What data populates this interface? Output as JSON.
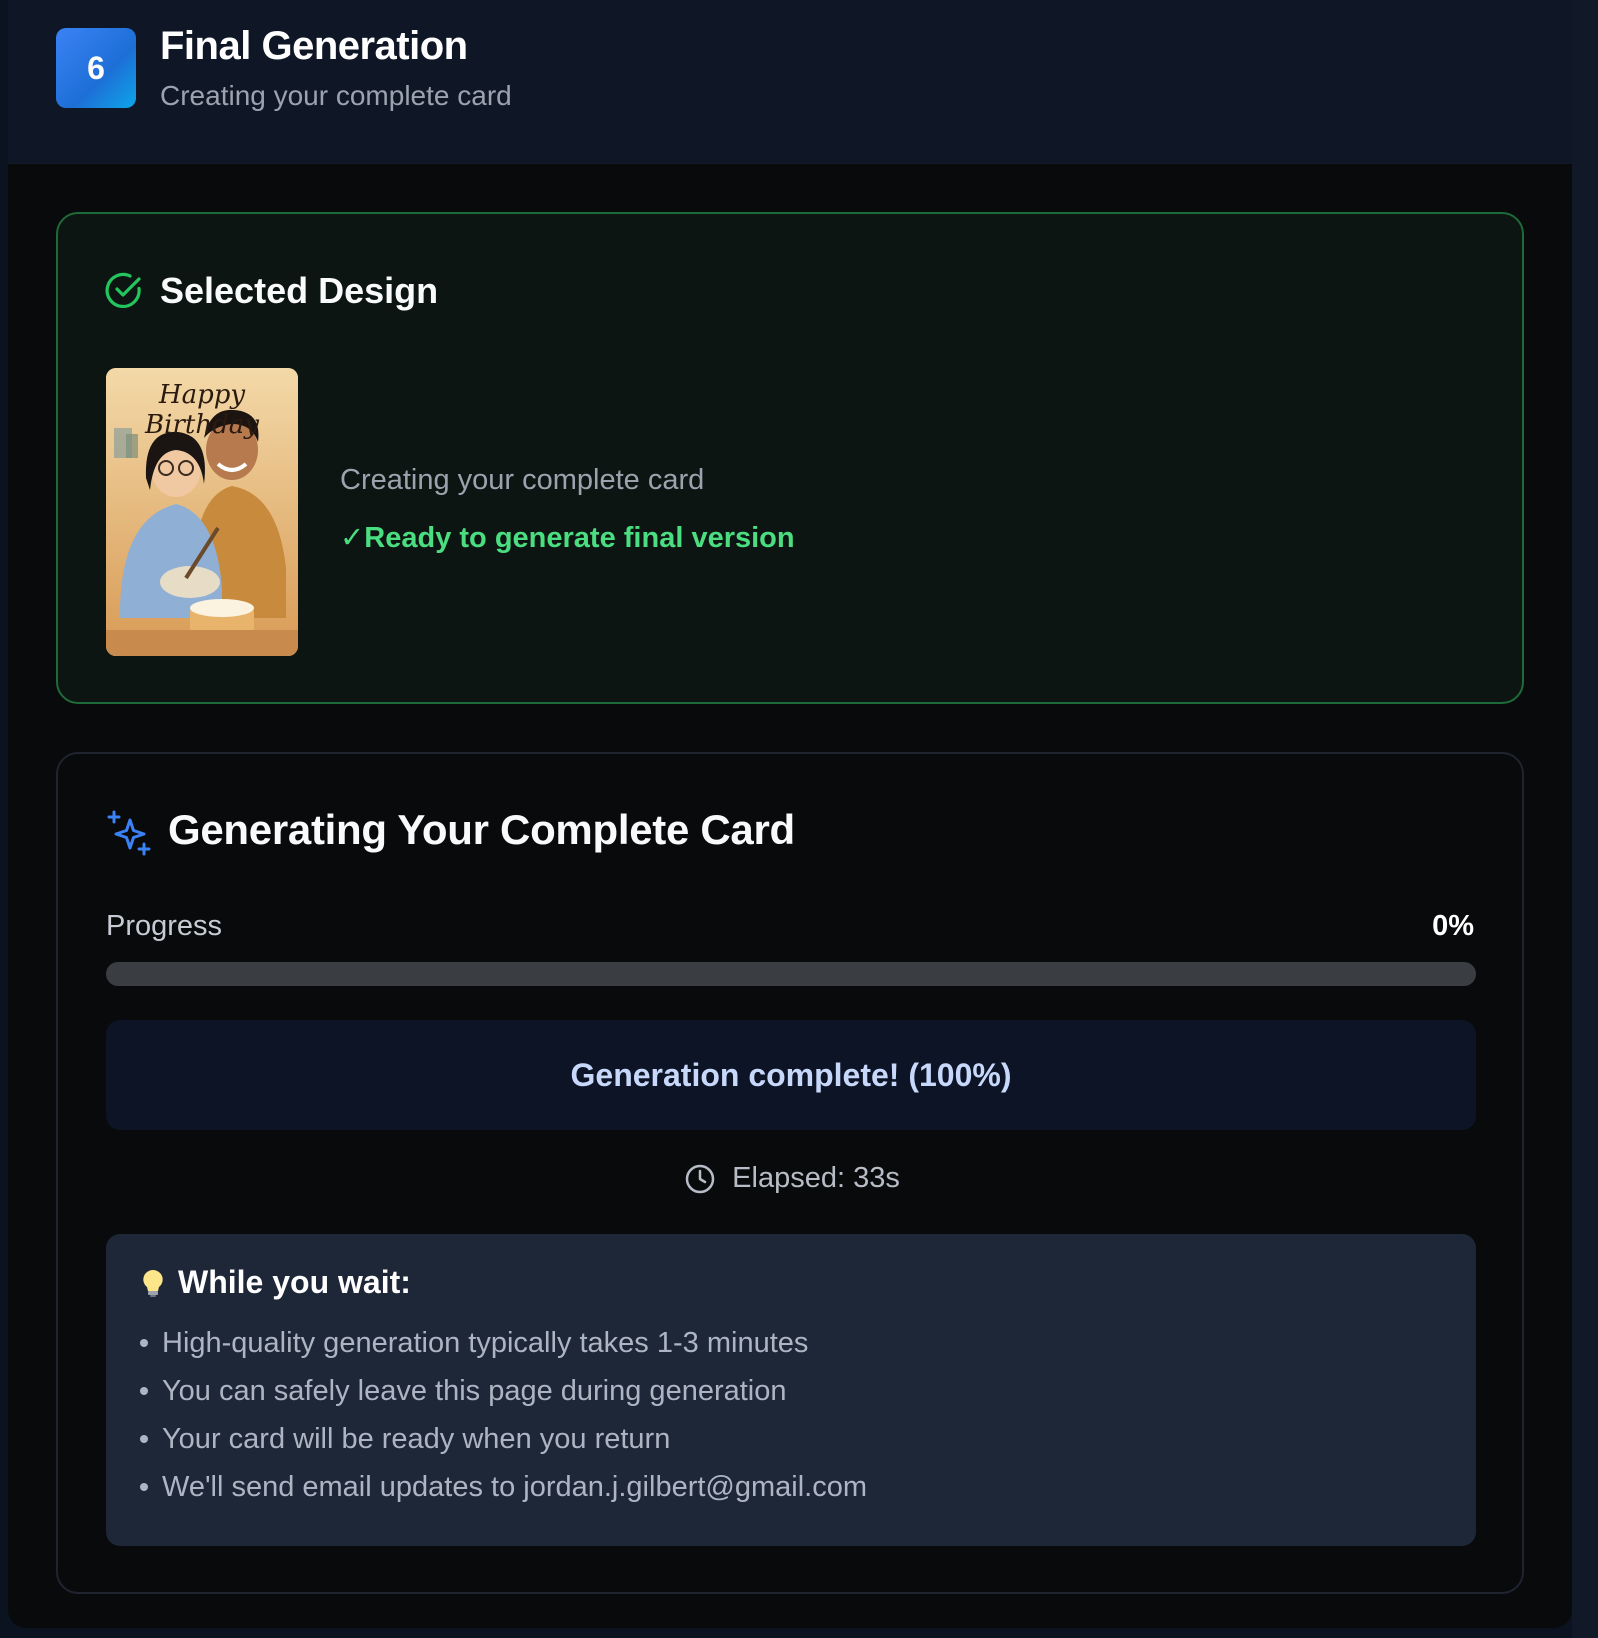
{
  "header": {
    "step_number": "6",
    "title": "Final Generation",
    "subtitle": "Creating your complete card"
  },
  "selected_design": {
    "title": "Selected Design",
    "thumbnail_text": "Happy Birthday",
    "status": "Creating your complete card",
    "ready_text": "✓Ready to generate final version"
  },
  "generation": {
    "title": "Generating Your Complete Card",
    "progress_label": "Progress",
    "progress_value": "0%",
    "progress_fraction": 0,
    "complete_message": "Generation complete! (100%)",
    "elapsed": "Elapsed: 33s"
  },
  "tips": {
    "title": "While you wait:",
    "items": [
      "High-quality generation typically takes 1-3 minutes",
      "You can safely leave this page during generation",
      "Your card will be ready when you return",
      "We'll send email updates to jordan.j.gilbert@gmail.com"
    ]
  },
  "colors": {
    "accent_blue": "#3b82f6",
    "success_green": "#4ade80",
    "card_border_green": "#1d6b38",
    "background": "#090a0b"
  },
  "icons": {
    "check": "check-circle-icon",
    "sparkle": "sparkles-icon",
    "clock": "clock-icon",
    "bulb": "lightbulb-icon"
  }
}
